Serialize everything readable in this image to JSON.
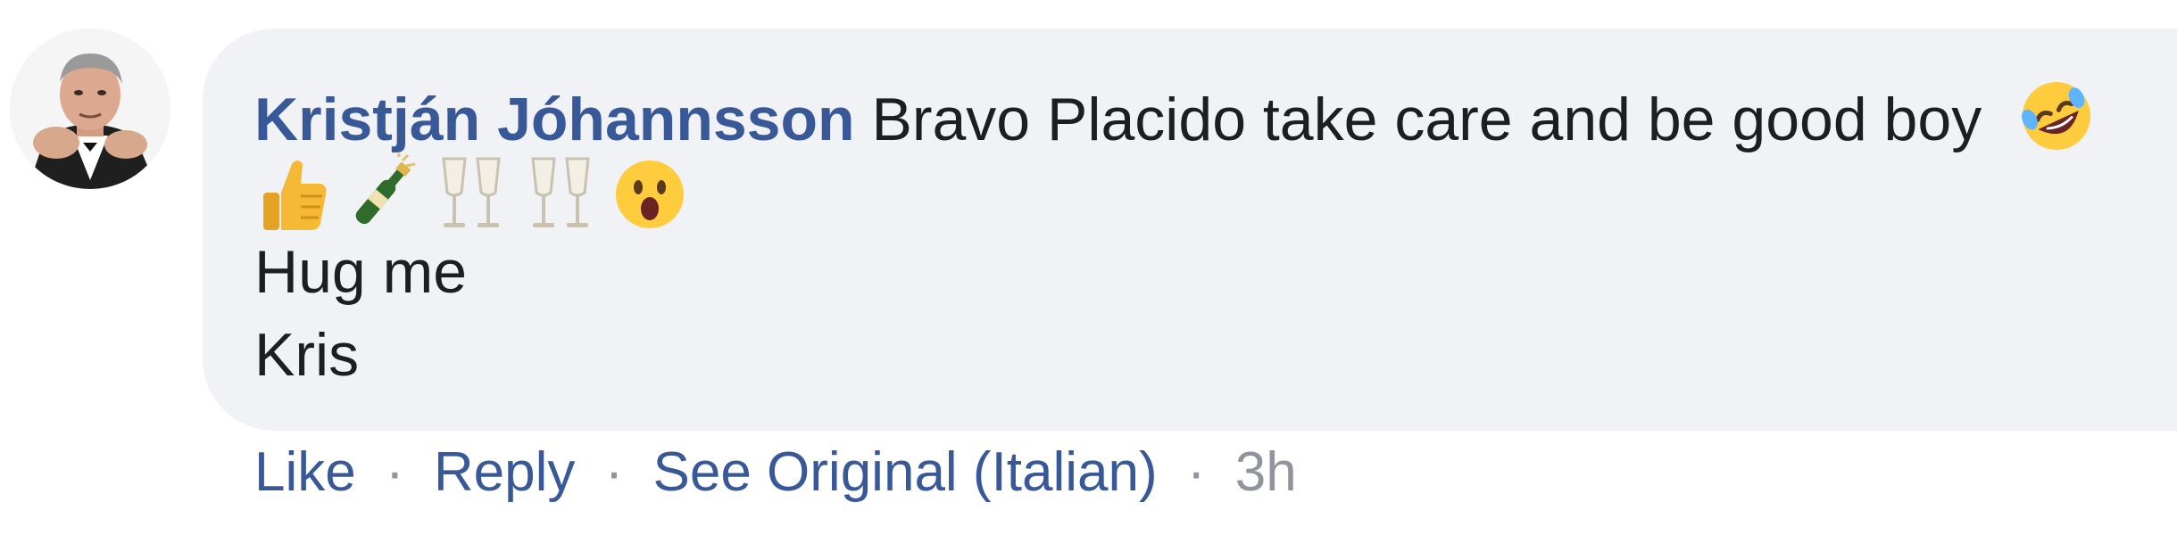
{
  "comment": {
    "author": "Kristján Jóhannsson",
    "text_line1": "Bravo Placido take care and be good boy",
    "emoji_line": [
      "thumbs-up",
      "champagne-bottle",
      "clinking-glasses",
      "clinking-glasses",
      "astonished-face"
    ],
    "inline_emoji": "rolling-on-floor-laughing",
    "text_line3": "Hug me",
    "text_line4": "Kris"
  },
  "actions": {
    "like": "Like",
    "reply": "Reply",
    "see_original": "See Original (Italian)",
    "separator": "·",
    "timestamp": "3h"
  },
  "colors": {
    "author": "#385898",
    "bubble_bg": "#f0f2f5",
    "text": "#1c1e21",
    "meta": "#90949c"
  }
}
